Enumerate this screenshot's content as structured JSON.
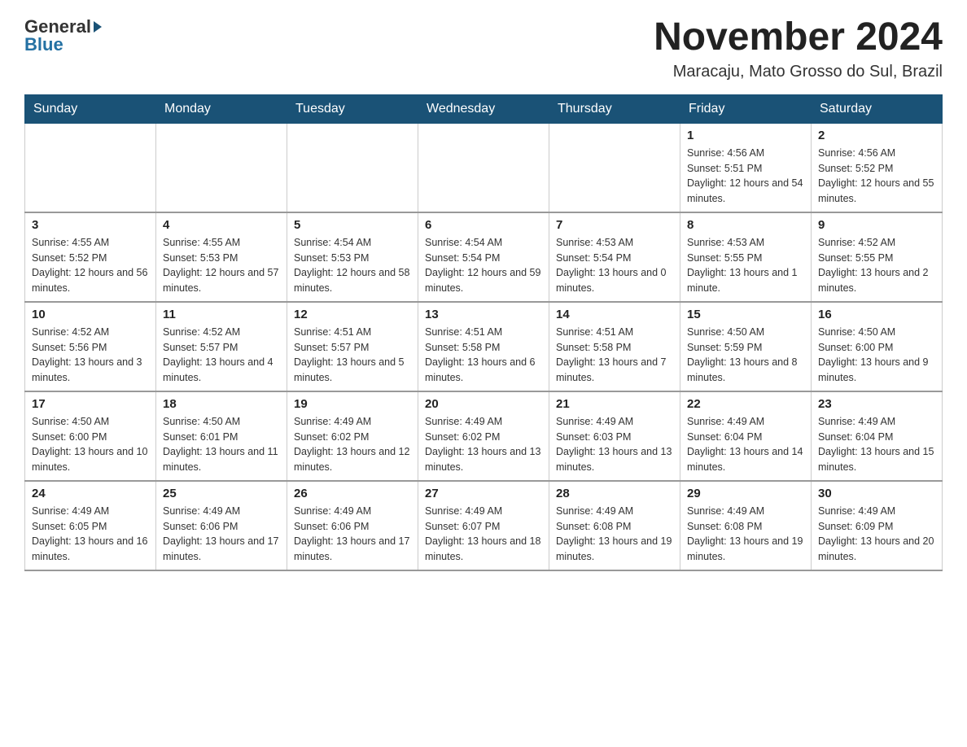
{
  "header": {
    "logo_general": "General",
    "logo_blue": "Blue",
    "title": "November 2024",
    "subtitle": "Maracaju, Mato Grosso do Sul, Brazil"
  },
  "calendar": {
    "days_of_week": [
      "Sunday",
      "Monday",
      "Tuesday",
      "Wednesday",
      "Thursday",
      "Friday",
      "Saturday"
    ],
    "weeks": [
      [
        {
          "day": "",
          "info": ""
        },
        {
          "day": "",
          "info": ""
        },
        {
          "day": "",
          "info": ""
        },
        {
          "day": "",
          "info": ""
        },
        {
          "day": "",
          "info": ""
        },
        {
          "day": "1",
          "info": "Sunrise: 4:56 AM\nSunset: 5:51 PM\nDaylight: 12 hours and 54 minutes."
        },
        {
          "day": "2",
          "info": "Sunrise: 4:56 AM\nSunset: 5:52 PM\nDaylight: 12 hours and 55 minutes."
        }
      ],
      [
        {
          "day": "3",
          "info": "Sunrise: 4:55 AM\nSunset: 5:52 PM\nDaylight: 12 hours and 56 minutes."
        },
        {
          "day": "4",
          "info": "Sunrise: 4:55 AM\nSunset: 5:53 PM\nDaylight: 12 hours and 57 minutes."
        },
        {
          "day": "5",
          "info": "Sunrise: 4:54 AM\nSunset: 5:53 PM\nDaylight: 12 hours and 58 minutes."
        },
        {
          "day": "6",
          "info": "Sunrise: 4:54 AM\nSunset: 5:54 PM\nDaylight: 12 hours and 59 minutes."
        },
        {
          "day": "7",
          "info": "Sunrise: 4:53 AM\nSunset: 5:54 PM\nDaylight: 13 hours and 0 minutes."
        },
        {
          "day": "8",
          "info": "Sunrise: 4:53 AM\nSunset: 5:55 PM\nDaylight: 13 hours and 1 minute."
        },
        {
          "day": "9",
          "info": "Sunrise: 4:52 AM\nSunset: 5:55 PM\nDaylight: 13 hours and 2 minutes."
        }
      ],
      [
        {
          "day": "10",
          "info": "Sunrise: 4:52 AM\nSunset: 5:56 PM\nDaylight: 13 hours and 3 minutes."
        },
        {
          "day": "11",
          "info": "Sunrise: 4:52 AM\nSunset: 5:57 PM\nDaylight: 13 hours and 4 minutes."
        },
        {
          "day": "12",
          "info": "Sunrise: 4:51 AM\nSunset: 5:57 PM\nDaylight: 13 hours and 5 minutes."
        },
        {
          "day": "13",
          "info": "Sunrise: 4:51 AM\nSunset: 5:58 PM\nDaylight: 13 hours and 6 minutes."
        },
        {
          "day": "14",
          "info": "Sunrise: 4:51 AM\nSunset: 5:58 PM\nDaylight: 13 hours and 7 minutes."
        },
        {
          "day": "15",
          "info": "Sunrise: 4:50 AM\nSunset: 5:59 PM\nDaylight: 13 hours and 8 minutes."
        },
        {
          "day": "16",
          "info": "Sunrise: 4:50 AM\nSunset: 6:00 PM\nDaylight: 13 hours and 9 minutes."
        }
      ],
      [
        {
          "day": "17",
          "info": "Sunrise: 4:50 AM\nSunset: 6:00 PM\nDaylight: 13 hours and 10 minutes."
        },
        {
          "day": "18",
          "info": "Sunrise: 4:50 AM\nSunset: 6:01 PM\nDaylight: 13 hours and 11 minutes."
        },
        {
          "day": "19",
          "info": "Sunrise: 4:49 AM\nSunset: 6:02 PM\nDaylight: 13 hours and 12 minutes."
        },
        {
          "day": "20",
          "info": "Sunrise: 4:49 AM\nSunset: 6:02 PM\nDaylight: 13 hours and 13 minutes."
        },
        {
          "day": "21",
          "info": "Sunrise: 4:49 AM\nSunset: 6:03 PM\nDaylight: 13 hours and 13 minutes."
        },
        {
          "day": "22",
          "info": "Sunrise: 4:49 AM\nSunset: 6:04 PM\nDaylight: 13 hours and 14 minutes."
        },
        {
          "day": "23",
          "info": "Sunrise: 4:49 AM\nSunset: 6:04 PM\nDaylight: 13 hours and 15 minutes."
        }
      ],
      [
        {
          "day": "24",
          "info": "Sunrise: 4:49 AM\nSunset: 6:05 PM\nDaylight: 13 hours and 16 minutes."
        },
        {
          "day": "25",
          "info": "Sunrise: 4:49 AM\nSunset: 6:06 PM\nDaylight: 13 hours and 17 minutes."
        },
        {
          "day": "26",
          "info": "Sunrise: 4:49 AM\nSunset: 6:06 PM\nDaylight: 13 hours and 17 minutes."
        },
        {
          "day": "27",
          "info": "Sunrise: 4:49 AM\nSunset: 6:07 PM\nDaylight: 13 hours and 18 minutes."
        },
        {
          "day": "28",
          "info": "Sunrise: 4:49 AM\nSunset: 6:08 PM\nDaylight: 13 hours and 19 minutes."
        },
        {
          "day": "29",
          "info": "Sunrise: 4:49 AM\nSunset: 6:08 PM\nDaylight: 13 hours and 19 minutes."
        },
        {
          "day": "30",
          "info": "Sunrise: 4:49 AM\nSunset: 6:09 PM\nDaylight: 13 hours and 20 minutes."
        }
      ]
    ]
  }
}
